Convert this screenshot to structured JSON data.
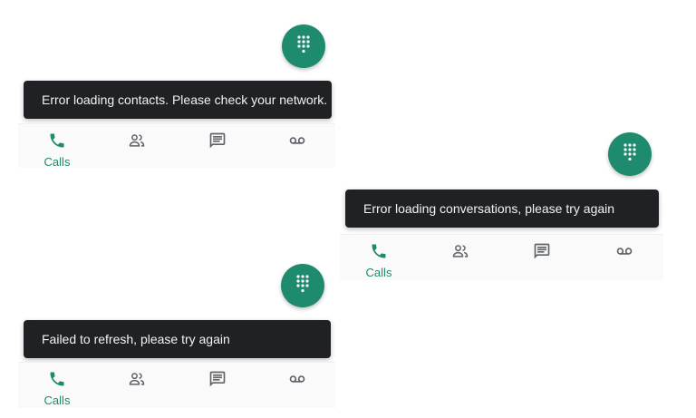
{
  "colors": {
    "accent": "#1e8a6e",
    "snackbar_bg": "#202124",
    "icon_grey": "#5f6368"
  },
  "panels": [
    {
      "snackbar_text": "Error loading contacts. Please check your network.",
      "nav": {
        "calls_label": "Calls",
        "icons": [
          "phone-icon",
          "contacts-icon",
          "messages-icon",
          "voicemail-icon"
        ]
      },
      "fab_icon": "dialpad-icon"
    },
    {
      "snackbar_text": "Error loading conversations, please try again",
      "nav": {
        "calls_label": "Calls",
        "icons": [
          "phone-icon",
          "contacts-icon",
          "messages-icon",
          "voicemail-icon"
        ]
      },
      "fab_icon": "dialpad-icon"
    },
    {
      "snackbar_text": "Failed to refresh, please try again",
      "nav": {
        "calls_label": "Calls",
        "icons": [
          "phone-icon",
          "contacts-icon",
          "messages-icon",
          "voicemail-icon"
        ]
      },
      "fab_icon": "dialpad-icon"
    }
  ]
}
